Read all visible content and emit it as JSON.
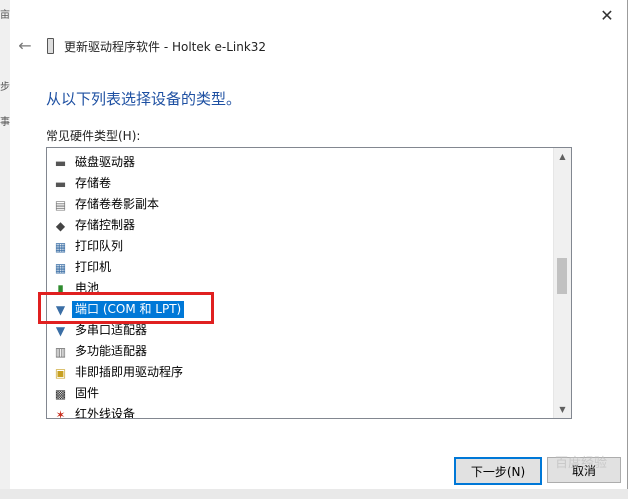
{
  "background": {
    "left_glyphs": [
      "亩",
      "步",
      "事"
    ]
  },
  "dialog": {
    "title": "更新驱动程序软件 - Holtek e-Link32",
    "heading": "从以下列表选择设备的类型。",
    "list_label": "常见硬件类型(H):",
    "items": [
      {
        "label": "磁盘驱动器",
        "icon": "disk-drive-icon",
        "color": "#555555"
      },
      {
        "label": "存储卷",
        "icon": "storage-volume-icon",
        "color": "#555555"
      },
      {
        "label": "存储卷卷影副本",
        "icon": "shadow-copy-icon",
        "color": "#777777"
      },
      {
        "label": "存储控制器",
        "icon": "storage-controller-icon",
        "color": "#444444"
      },
      {
        "label": "打印队列",
        "icon": "print-queue-icon",
        "color": "#3a6ea5"
      },
      {
        "label": "打印机",
        "icon": "printer-icon",
        "color": "#3a6ea5"
      },
      {
        "label": "电池",
        "icon": "battery-icon",
        "color": "#2e8b2e"
      },
      {
        "label": "端口 (COM 和 LPT)",
        "icon": "port-icon",
        "color": "#3a6ea5",
        "selected": true
      },
      {
        "label": "多串口适配器",
        "icon": "multiport-serial-icon",
        "color": "#3a6ea5"
      },
      {
        "label": "多功能适配器",
        "icon": "multifunction-adapter-icon",
        "color": "#666666"
      },
      {
        "label": "非即插即用驱动程序",
        "icon": "non-pnp-driver-icon",
        "color": "#c8a020"
      },
      {
        "label": "固件",
        "icon": "firmware-icon",
        "color": "#333333"
      },
      {
        "label": "红外线设备",
        "icon": "infrared-icon",
        "color": "#c83020"
      }
    ],
    "buttons": {
      "next": "下一步(N)",
      "cancel": "取消"
    }
  },
  "watermark": "百度经验",
  "colors": {
    "heading": "#1e50a2",
    "selection": "#0078d7",
    "annotation": "#e02020"
  }
}
